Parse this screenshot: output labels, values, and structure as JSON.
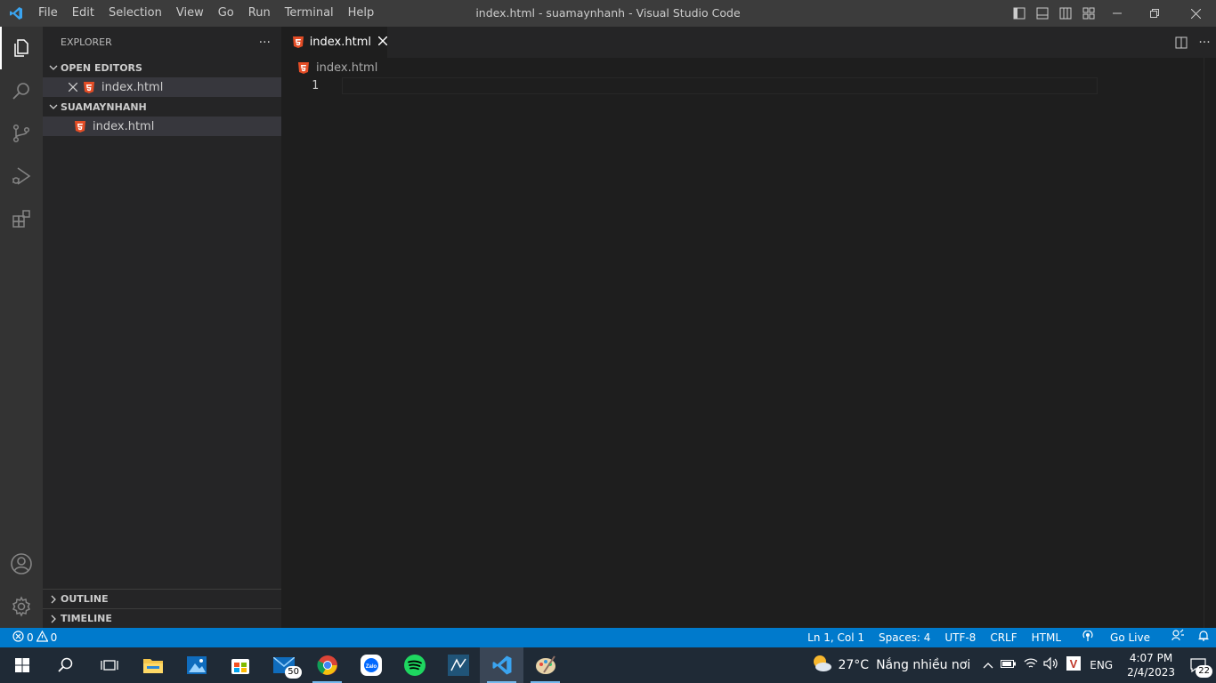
{
  "titlebar": {
    "menu": [
      "File",
      "Edit",
      "Selection",
      "View",
      "Go",
      "Run",
      "Terminal",
      "Help"
    ],
    "title": "index.html - suamaynhanh - Visual Studio Code"
  },
  "activity_bar": {
    "items": [
      "explorer-icon",
      "search-icon",
      "source-control-icon",
      "run-debug-icon",
      "extensions-icon"
    ],
    "bottom": [
      "account-icon",
      "settings-gear-icon"
    ]
  },
  "sidebar": {
    "title": "EXPLORER",
    "more": "···",
    "open_editors": {
      "label": "OPEN EDITORS",
      "files": [
        {
          "name": "index.html"
        }
      ]
    },
    "folder": {
      "label": "SUAMAYNHANH",
      "files": [
        {
          "name": "index.html"
        }
      ]
    },
    "outline": "OUTLINE",
    "timeline": "TIMELINE"
  },
  "editor": {
    "tab": {
      "label": "index.html"
    },
    "breadcrumb": "index.html",
    "line_number": "1",
    "more": "···"
  },
  "statusbar": {
    "errors": "0",
    "warnings": "0",
    "position": "Ln 1, Col 1",
    "spaces": "Spaces: 4",
    "encoding": "UTF-8",
    "eol": "CRLF",
    "language": "HTML",
    "golive": "Go Live"
  },
  "taskbar": {
    "mail_badge": "50",
    "weather_temp": "27°C",
    "weather_text": "Nắng nhiều nơi",
    "language": "ENG",
    "time": "4:07 PM",
    "date": "2/4/2023",
    "notification_count": "22"
  },
  "colors": {
    "accent": "#007acc",
    "html_icon": "#e44d26"
  }
}
